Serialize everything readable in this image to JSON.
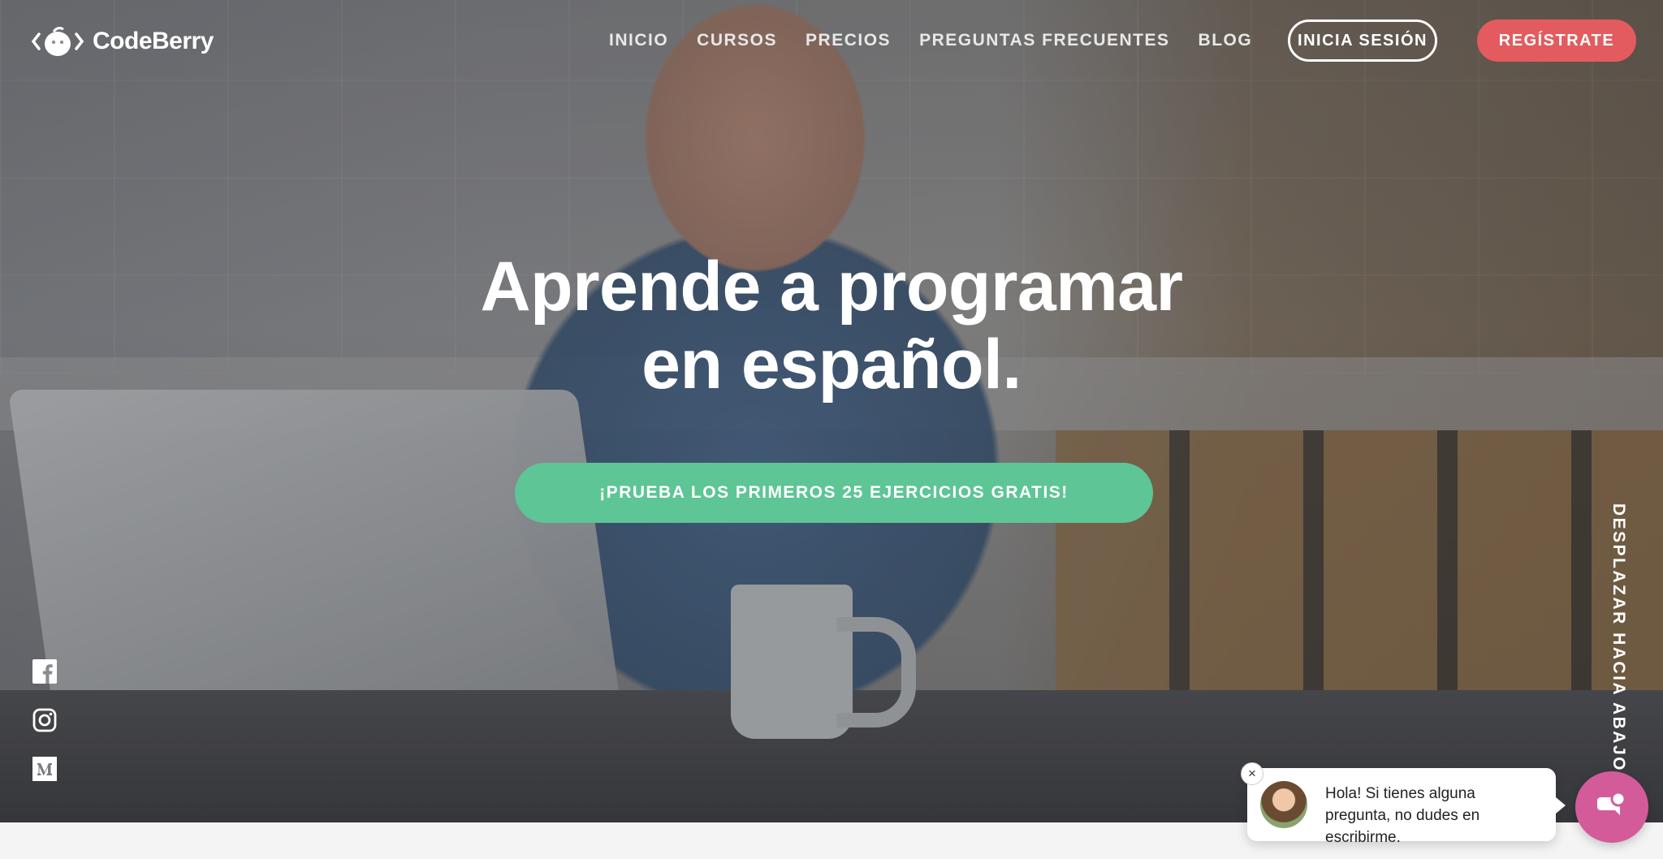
{
  "brand": {
    "name": "CodeBerry"
  },
  "nav": {
    "items": [
      "INICIO",
      "CURSOS",
      "PRECIOS",
      "PREGUNTAS FRECUENTES",
      "BLOG"
    ]
  },
  "auth": {
    "login_label": "INICIA SESIÓN",
    "register_label": "REGÍSTRATE"
  },
  "hero": {
    "headline_line1": "Aprende a programar",
    "headline_line2": "en español.",
    "cta_label": "¡PRUEBA LOS PRIMEROS 25 EJERCICIOS GRATIS!",
    "scroll_hint": "DESPLAZAR HACIA ABAJO"
  },
  "social": {
    "icons": [
      "facebook-icon",
      "instagram-icon",
      "medium-icon"
    ]
  },
  "chat": {
    "message": "Hola! Si tienes alguna pregunta, no dudes en escribirme.",
    "close_symbol": "×"
  },
  "colors": {
    "register_button": "#e35b5e",
    "cta_button": "#5ec596",
    "chat_launcher": "#d45b9a"
  }
}
